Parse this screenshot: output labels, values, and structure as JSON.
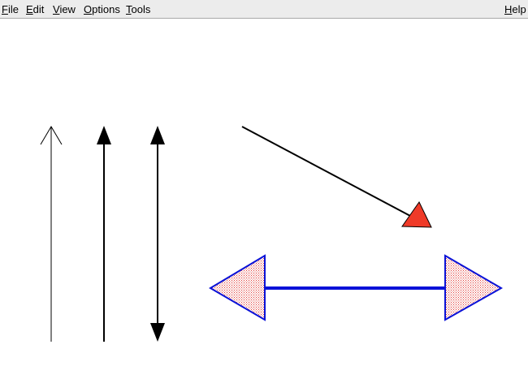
{
  "menubar": {
    "items": [
      {
        "mnemonic": "F",
        "rest": "ile"
      },
      {
        "mnemonic": "E",
        "rest": "dit"
      },
      {
        "mnemonic": "V",
        "rest": "iew"
      },
      {
        "mnemonic": "O",
        "rest": "ptions"
      },
      {
        "mnemonic": "T",
        "rest": "ools"
      }
    ],
    "help": {
      "mnemonic": "H",
      "rest": "elp"
    }
  },
  "canvas": {
    "background": "#ffffff",
    "colors": {
      "black": "#000000",
      "blue": "#0a12d8",
      "red_fill": "#ef3a28",
      "stipple_red": "#e3403a",
      "stipple_bg": "#ffffff"
    },
    "arrows": [
      {
        "name": "thin-open-arrow",
        "style": "open-head",
        "color": "black"
      },
      {
        "name": "filled-arrow",
        "style": "filled-head",
        "color": "black"
      },
      {
        "name": "double-ended-arrow",
        "style": "filled-both-ends",
        "color": "black"
      },
      {
        "name": "diagonal-arrow",
        "style": "filled-red-head",
        "color": "black"
      },
      {
        "name": "blue-double-arrow",
        "style": "stippled-both-ends",
        "color": "blue"
      }
    ]
  }
}
